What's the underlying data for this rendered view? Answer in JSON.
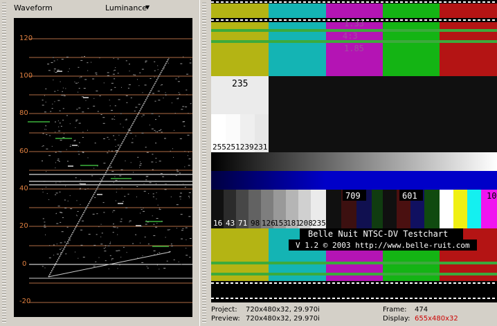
{
  "waveform_panel": {
    "title": "Waveform",
    "mode": "Luminance",
    "dropdown_arrow": "chevron-down",
    "scale_labels": [
      "120",
      "100",
      "80",
      "60",
      "40",
      "20",
      "0",
      "-20"
    ]
  },
  "testchart": {
    "title_line": "Belle Nuit NTSC-DV Testchart",
    "credit_line": "V 1.2 © 2003 http://www.belle-ruit.com",
    "ratio_lines": [
      "1.33",
      "4:3",
      "1.85"
    ],
    "label_235": "235",
    "white_steps_labels": "255251239231",
    "gray_steps_labels": [
      "16",
      "43",
      "71",
      "98",
      "126",
      "153",
      "181",
      "208",
      "235"
    ],
    "label_709": "709",
    "label_601": "601",
    "label_10": "10"
  },
  "status": {
    "project_label": "Project:",
    "project_value": "720x480x32, 29.970i",
    "preview_label": "Preview:",
    "preview_value": "720x480x32, 29.970i",
    "frame_label": "Frame:",
    "frame_value": "474",
    "display_label": "Display:",
    "display_value": "655x480x32",
    "display_value_color": "#cc0000"
  }
}
